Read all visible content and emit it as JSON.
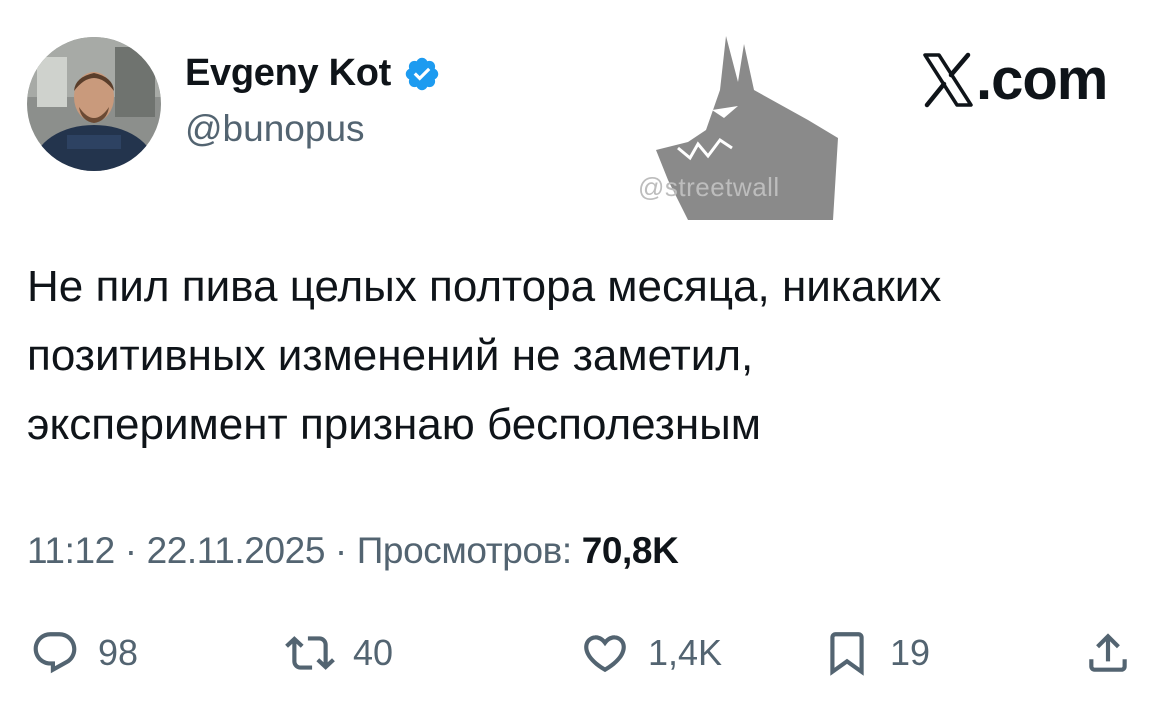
{
  "author": {
    "display_name": "Evgeny Kot",
    "handle": "@bunopus",
    "verified": true,
    "verified_color": "#1d9bf0"
  },
  "brand": {
    "label": ".com",
    "icon": "x-logo-icon"
  },
  "watermark": {
    "text": "@streetwall",
    "icon": "wolf-head-icon",
    "color": "#8a8a8a"
  },
  "tweet": {
    "lines": [
      "Не пил пива целых полтора месяца, никаких",
      "позитивных изменений не заметил,",
      "эксперимент признаю бесполезным"
    ]
  },
  "meta": {
    "time": "11:12",
    "separator": "·",
    "date": "22.11.2025",
    "views_label": "Просмотров:",
    "views_count": "70,8K"
  },
  "actions": {
    "reply": {
      "icon": "reply-icon",
      "count": "98"
    },
    "retweet": {
      "icon": "retweet-icon",
      "count": "40"
    },
    "like": {
      "icon": "heart-icon",
      "count": "1,4K"
    },
    "bookmark": {
      "icon": "bookmark-icon",
      "count": "19"
    },
    "share": {
      "icon": "share-icon"
    }
  },
  "colors": {
    "text": "#0f1419",
    "secondary": "#536471",
    "background": "#ffffff"
  }
}
